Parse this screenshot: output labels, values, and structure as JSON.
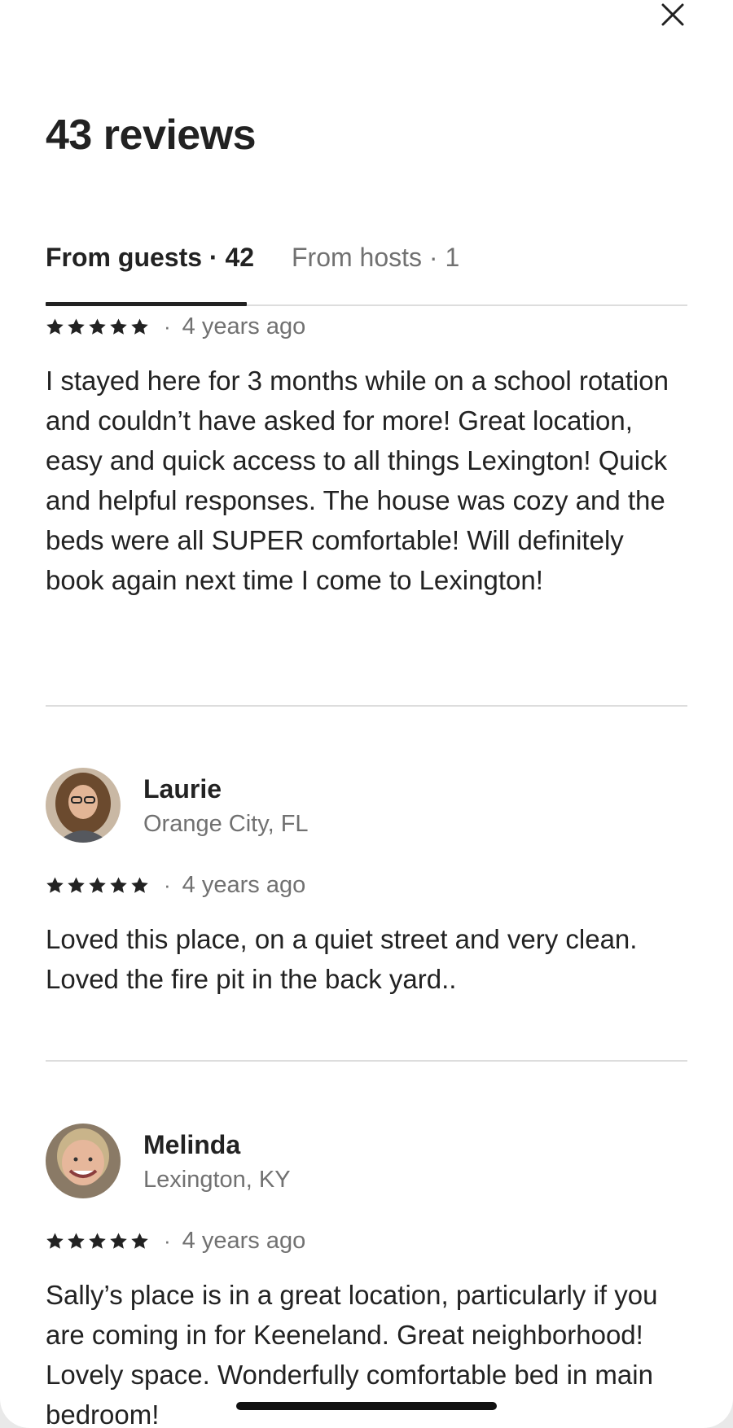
{
  "header": {
    "title": "43 reviews",
    "close_icon": "close-icon"
  },
  "tabs": [
    {
      "label": "From guests · 42",
      "active": true
    },
    {
      "label": "From hosts · 1",
      "active": false
    }
  ],
  "reviews": [
    {
      "name": "",
      "location": "",
      "rating": 5,
      "date": "4 years ago",
      "text": "I stayed here for 3 months while on a school rotation and couldn’t have asked for more! Great location, easy and quick access to all things Lexington! Quick and helpful responses. The house was cozy and the beds were all SUPER comfortable! Will definitely book again next time I come to Lexington!"
    },
    {
      "name": "Laurie",
      "location": "Orange City, FL",
      "rating": 5,
      "date": "4 years ago",
      "text": "Loved this place, on a quiet street and very clean. Loved the fire pit in the back yard.."
    },
    {
      "name": "Melinda",
      "location": "Lexington, KY",
      "rating": 5,
      "date": "4 years ago",
      "text": "Sally’s place is in a great location, particularly if you are coming in for Keeneland. Great neighborhood! Lovely space. Wonderfully comfortable bed in main bedroom!"
    }
  ],
  "meta_separator": "·",
  "colors": {
    "text_primary": "#222222",
    "text_secondary": "#717171",
    "divider": "#dddddd"
  }
}
